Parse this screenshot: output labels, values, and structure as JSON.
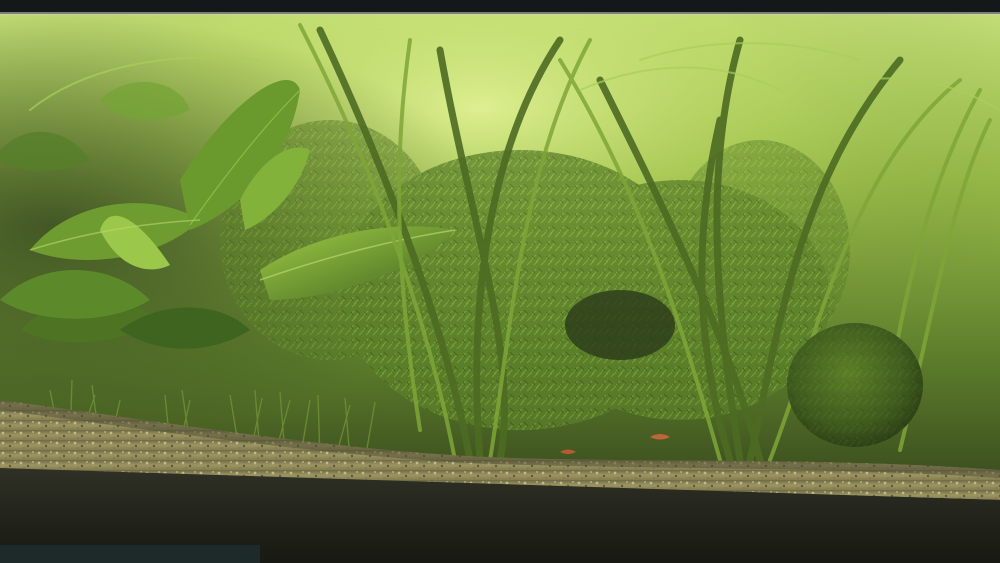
{
  "scene": {
    "subject": "aquarium-planted-tank",
    "elements": [
      "tank-rim",
      "water-column",
      "broadleaf-plants",
      "ribbon-leaf-plants",
      "fine-moss-thicket",
      "grass-carpet",
      "moss-ball",
      "shrimp",
      "gravel-substrate",
      "substrate-glass-band"
    ]
  },
  "colors": {
    "rim": "#15181a",
    "water_light": "#b7d66a",
    "water_mid": "#7fa33c",
    "water_dark": "#2d3f1a",
    "leaf_light": "#8fbf3a",
    "leaf_dark": "#3d5e1c",
    "ribbon": "#5f7d2a",
    "moss": "#4a6a22",
    "moss_ball": "#3c5418",
    "gravel": "#a19a66",
    "gravel_shadow": "#4e4c32",
    "substrate_band": "#2a2c22",
    "shrimp": "#c2643a"
  }
}
